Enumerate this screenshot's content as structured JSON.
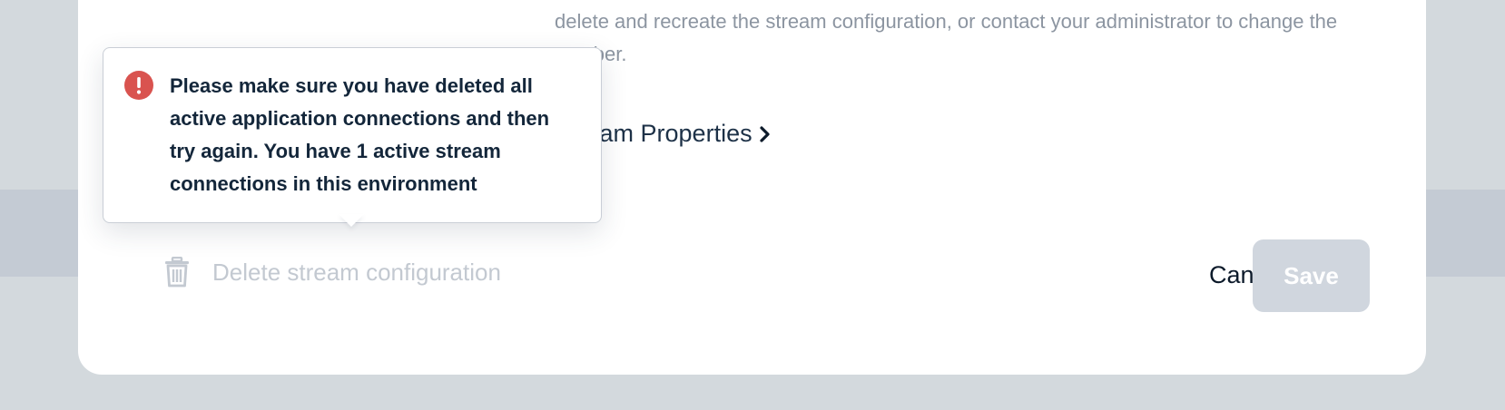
{
  "modal": {
    "body_text": "delete and recreate the stream configuration, or contact your administrator to change the number.",
    "properties_link": "Stream Properties",
    "delete_label": "Delete stream configuration",
    "cancel_label": "Cancel",
    "save_label": "Save"
  },
  "tooltip": {
    "message": "Please make sure you have deleted all active application connections and then try again. You have 1 active stream connections in this environment"
  },
  "icons": {
    "error": "error-exclamation-icon",
    "chevron": "chevron-right-icon",
    "trash": "trash-icon"
  },
  "colors": {
    "error": "#d9534f",
    "save_disabled": "#d0d6de",
    "text_dark": "#13263a"
  }
}
